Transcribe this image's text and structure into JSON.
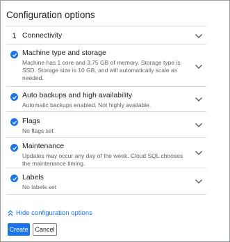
{
  "title": "Configuration options",
  "sections": [
    {
      "number": "1",
      "heading": "Connectivity",
      "description": "",
      "completed": false
    },
    {
      "number": "",
      "heading": "Machine type and storage",
      "description": "Machine has 1 core and 3.75 GB of memory. Storage type is SSD. Storage size is 10 GB, and will automatically scale as needed.",
      "completed": true
    },
    {
      "number": "",
      "heading": "Auto backups and high availability",
      "description": "Automatic backups enabled. Not highly available.",
      "completed": true
    },
    {
      "number": "",
      "heading": "Flags",
      "description": "No flags set",
      "completed": true
    },
    {
      "number": "",
      "heading": "Maintenance",
      "description": "Updates may occur any day of the week. Cloud SQL chooses the maintenance timing.",
      "completed": true
    },
    {
      "number": "",
      "heading": "Labels",
      "description": "No labels set",
      "completed": true
    }
  ],
  "hide_link": "Hide configuration options",
  "buttons": {
    "create": "Create",
    "cancel": "Cancel"
  },
  "colors": {
    "accent": "#1a73e8",
    "divider": "#dadce0",
    "secondary_text": "#5f6368"
  },
  "icons": {
    "completed": "check-circle-icon",
    "expand": "chevron-down-icon",
    "collapse": "double-chevron-up-icon"
  }
}
